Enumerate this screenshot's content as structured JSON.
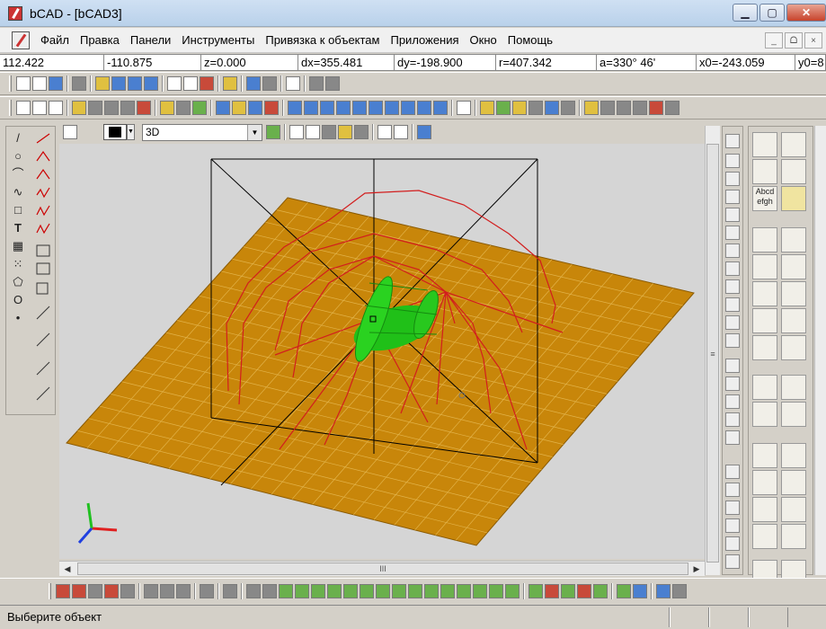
{
  "window": {
    "title": "bCAD - [bCAD3]",
    "minimize": "▁",
    "maximize": "▢",
    "close": "✕"
  },
  "menu": {
    "items": [
      "Файл",
      "Правка",
      "Панели",
      "Инструменты",
      "Привязка к объектам",
      "Приложения",
      "Окно",
      "Помощь"
    ],
    "mdi": [
      "_",
      "ᗝ",
      "×"
    ]
  },
  "coords": {
    "x": "112.422",
    "y": "-110.875",
    "z": "z=0.000",
    "dx": "dx=355.481",
    "dy": "dy=-198.900",
    "r": "r=407.342",
    "a": "a=330° 46'",
    "x0": "x0=-243.059",
    "y0": "y0=8"
  },
  "view_toolbar": {
    "view_mode": "3D"
  },
  "left_tools": [
    "/",
    "○",
    "⌒",
    "∿",
    "□",
    "T",
    "▦",
    "⁙",
    "⬠",
    "O",
    "•"
  ],
  "panel": {
    "text_tool": "Abcd efgh"
  },
  "hscroll": {
    "thumb": "III"
  },
  "vscroll": {
    "thumb": "≡"
  },
  "status": {
    "message": "Выберите объект"
  },
  "colors": {
    "floor": "#c8860a",
    "grid": "#e2b34a",
    "wire": "#d21e1e",
    "part": "#28c81e",
    "frame": "#000000"
  },
  "axis_icon": {
    "x_color": "#e02020",
    "y_color": "#20c020",
    "z_color": "#2040e0"
  }
}
